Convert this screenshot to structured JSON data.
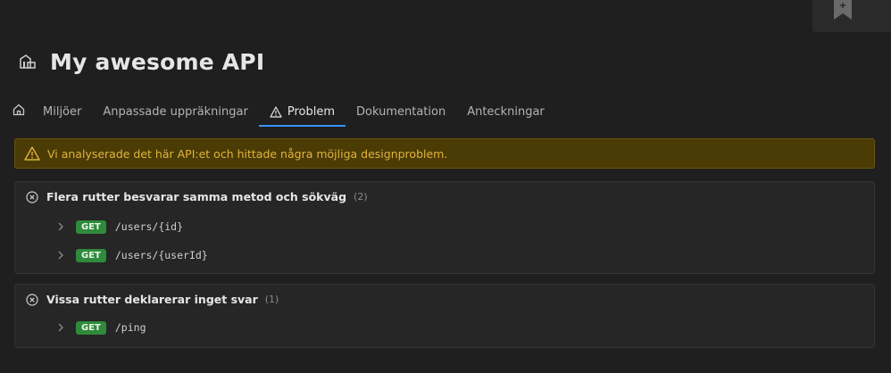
{
  "api": {
    "title": "My awesome API"
  },
  "tabs": [
    {
      "label": "Miljöer"
    },
    {
      "label": "Anpassade uppräkningar"
    },
    {
      "label": "Problem"
    },
    {
      "label": "Dokumentation"
    },
    {
      "label": "Anteckningar"
    }
  ],
  "banner": {
    "text": "Vi analyserade det här API:et och hittade några möjliga designproblem."
  },
  "issues": [
    {
      "title": "Flera rutter besvarar samma metod och sökväg",
      "count": "(2)",
      "routes": [
        {
          "method": "GET",
          "path": "/users/{id}"
        },
        {
          "method": "GET",
          "path": "/users/{userId}"
        }
      ]
    },
    {
      "title": "Vissa rutter deklarerar inget svar",
      "count": "(1)",
      "routes": [
        {
          "method": "GET",
          "path": "/ping"
        }
      ]
    }
  ],
  "colors": {
    "accent": "#3794ff",
    "warning_bg": "#4b3b05",
    "warning_text": "#e0b43c",
    "get_badge": "#2f8a3c"
  }
}
